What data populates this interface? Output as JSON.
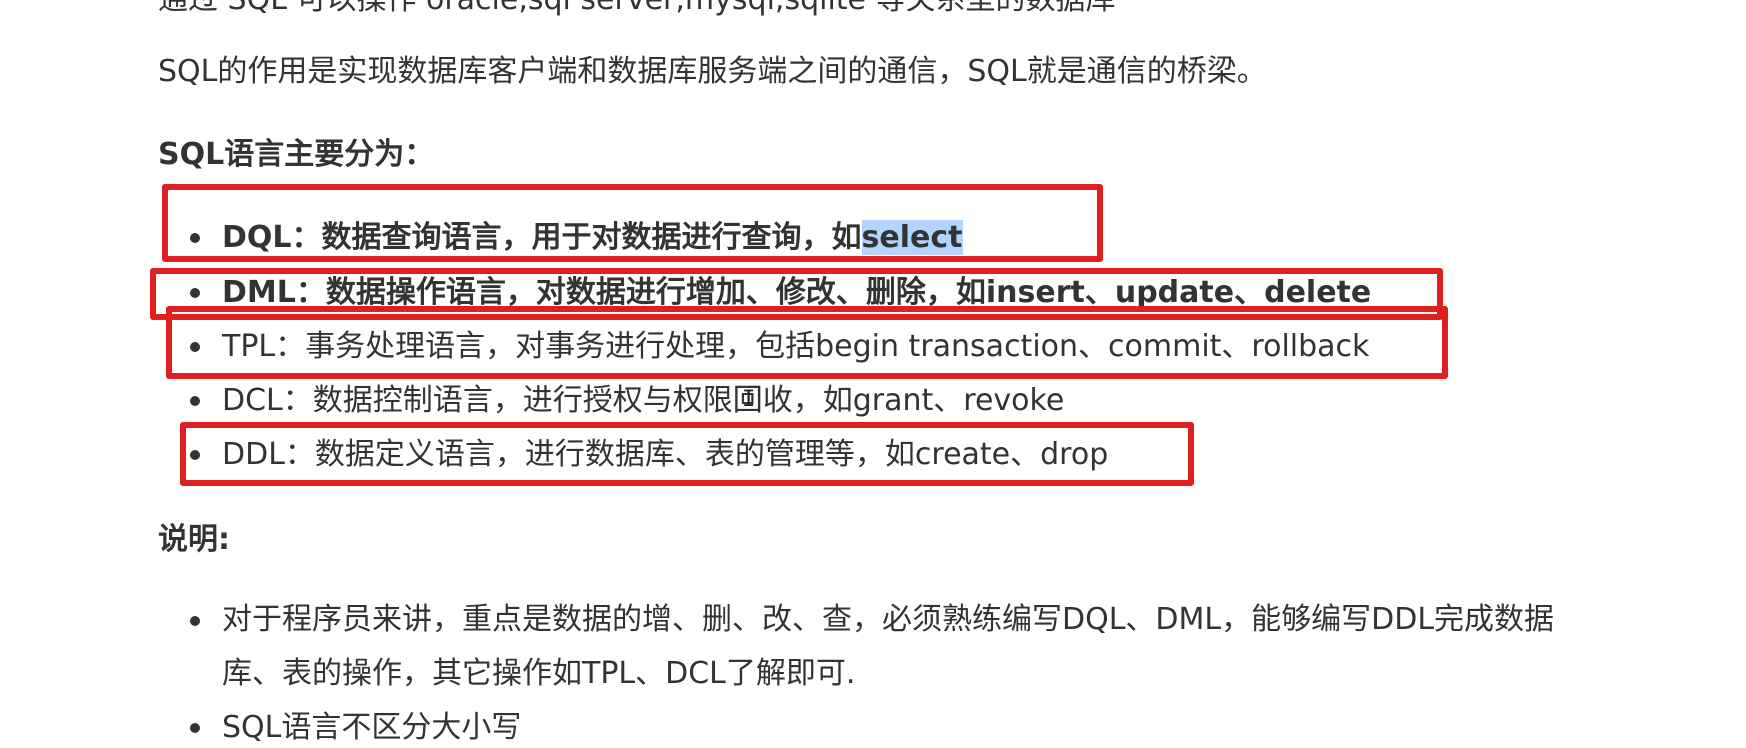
{
  "cutoff_line": "通过 SQL 可以操作 oracle,sql server,mysql,sqlite 等关系型的数据库",
  "intro_paragraph": "SQL的作用是实现数据库客户端和数据库服务端之间的通信，SQL就是通信的桥梁。",
  "categories_heading": "SQL语言主要分为：",
  "categories": {
    "dql": {
      "term": "DQL",
      "description": "：数据查询语言，用于对数据进行查询，如",
      "highlight": "select"
    },
    "dml": {
      "term": "DML",
      "description": "：数据操作语言，对数据进行增加、修改、删除，如insert、update、delete"
    },
    "tpl": {
      "text": "TPL：事务处理语言，对事务进行处理，包括begin transaction、commit、rollback"
    },
    "dcl": {
      "text": "DCL：数据控制语言，进行授权与权限回收，如grant、revoke"
    },
    "ddl": {
      "text": "DDL：数据定义语言，进行数据库、表的管理等，如create、drop"
    }
  },
  "notes_heading": "说明:",
  "notes": {
    "note1_line1": "对于程序员来讲，重点是数据的增、删、改、查，必须熟练编写DQL、DML，能够编写DDL完成数据",
    "note1_line2": "库、表的操作，其它操作如TPL、DCL了解即可.",
    "note2": "SQL语言不区分大小写"
  },
  "colors": {
    "text": "#333333",
    "annotation_box": "#e02020",
    "selection": "#b3d4fc"
  }
}
